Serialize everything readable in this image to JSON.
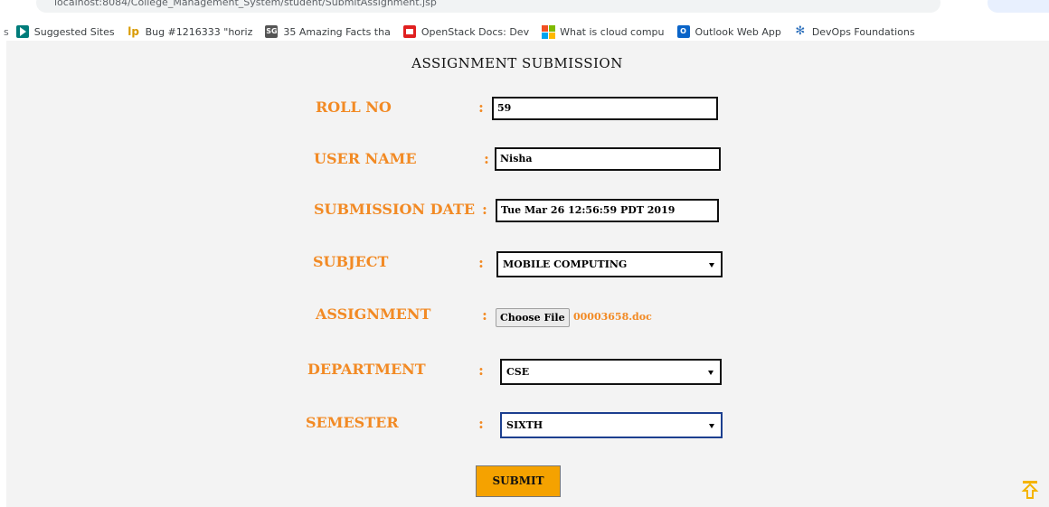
{
  "browser": {
    "url": "localhost:8084/College_Management_System/student/SubmitAssignment.jsp",
    "bookmarks": [
      {
        "label": "Suggested Sites",
        "icon": "bing-icon"
      },
      {
        "label": "Bug #1216333 \"horiz",
        "icon": "launchpad-icon"
      },
      {
        "label": "35 Amazing Facts tha",
        "icon": "sg-icon"
      },
      {
        "label": "OpenStack Docs: Dev",
        "icon": "openstack-icon"
      },
      {
        "label": "What is cloud compu",
        "icon": "microsoft-icon"
      },
      {
        "label": "Outlook Web App",
        "icon": "outlook-icon"
      },
      {
        "label": "DevOps Foundations",
        "icon": "devops-icon"
      }
    ]
  },
  "form": {
    "title": "ASSIGNMENT SUBMISSION",
    "colon": ":",
    "roll_no": {
      "label": "ROLL NO",
      "value": "59"
    },
    "user_name": {
      "label": "USER NAME",
      "value": "Nisha"
    },
    "submission_date": {
      "label": "SUBMISSION DATE",
      "value": "Tue Mar 26 12:56:59 PDT 2019"
    },
    "subject": {
      "label": "SUBJECT",
      "selected": "MOBILE COMPUTING"
    },
    "assignment": {
      "label": "ASSIGNMENT",
      "button_label": "Choose File",
      "file_name": "00003658.doc"
    },
    "department": {
      "label": "DEPARTMENT",
      "selected": "CSE"
    },
    "semester": {
      "label": "SEMESTER",
      "selected": "SIXTH"
    },
    "submit_label": "SUBMIT"
  },
  "colors": {
    "label": "#f28a24",
    "submit": "#f5a200",
    "page_background": "#f3f3f3"
  }
}
